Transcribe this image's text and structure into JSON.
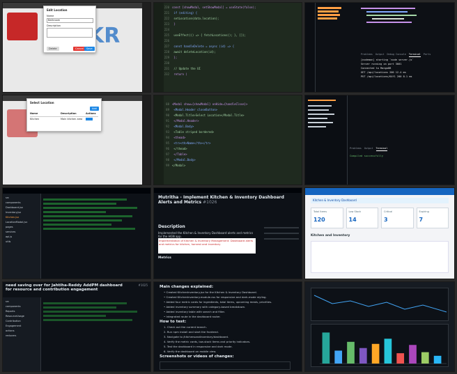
{
  "tiles": {
    "t1": {
      "dialog_title": "Edit Location",
      "field_name_label": "Name",
      "field_name_value": "Bathroom",
      "field_desc_label": "Description",
      "delete_label": "Delete",
      "cancel_label": "Cancel",
      "save_label": "Save",
      "logo_text": "KR"
    },
    "t2": {
      "lines": [
        {
          "n": "220",
          "code": "const [showModal, setShowModal] = useState(false);"
        },
        {
          "n": "221",
          "code": "  if (editing) {"
        },
        {
          "n": "222",
          "code": "    setLocation(data.location);"
        },
        {
          "n": "223",
          "code": "  }"
        },
        {
          "n": "224",
          "code": ""
        },
        {
          "n": "225",
          "code": "  useEffect(() => { fetchLocations(); }, []);"
        },
        {
          "n": "226",
          "code": ""
        },
        {
          "n": "227",
          "code": "  const handleDelete = async (id) => {"
        },
        {
          "n": "228",
          "code": "    await deleteLocation(id);"
        },
        {
          "n": "229",
          "code": "  };"
        },
        {
          "n": "230",
          "code": ""
        },
        {
          "n": "231",
          "code": "  // Update the UI"
        },
        {
          "n": "232",
          "code": "  return ("
        }
      ]
    },
    "t3": {
      "panel_tabs": [
        "Problems",
        "Output",
        "Debug Console",
        "Terminal",
        "Ports"
      ],
      "active_tab": "Terminal",
      "terminal_lines": [
        "[nodemon] starting `node server.js`",
        "Server running on port 3001",
        "Connected to MongoDB",
        "GET /api/locations 200 12.4 ms",
        "PUT /api/locations/64f1 200 8.1 ms"
      ]
    },
    "t4": {
      "dialog_title": "Select Location",
      "col_name": "Name",
      "col_description": "Description",
      "col_actions": "Actions",
      "row_name": "Kitchen",
      "row_desc": "Main kitchen area",
      "add_label": "Add"
    },
    "t5": {
      "lines": [
        {
          "n": "88",
          "code": "<Modal show={showModal} onHide={handleClose}>"
        },
        {
          "n": "89",
          "code": "  <Modal.Header closeButton>"
        },
        {
          "n": "90",
          "code": "    <Modal.Title>Select Location</Modal.Title>"
        },
        {
          "n": "91",
          "code": "  </Modal.Header>"
        },
        {
          "n": "92",
          "code": "  <Modal.Body>"
        },
        {
          "n": "93",
          "code": "    <Table striped bordered>"
        },
        {
          "n": "94",
          "code": "      <thead>"
        },
        {
          "n": "95",
          "code": "        <tr><th>Name</th></tr>"
        },
        {
          "n": "96",
          "code": "      </thead>"
        },
        {
          "n": "97",
          "code": "    </Table>"
        },
        {
          "n": "98",
          "code": "  </Modal.Body>"
        },
        {
          "n": "99",
          "code": "</Modal>"
        }
      ]
    },
    "t6": {
      "panel_tabs": [
        "Problems",
        "Output",
        "Terminal"
      ],
      "status": "Compiled successfully"
    },
    "t7": {
      "tree": [
        "src",
        "components",
        "Dashboard.jsx",
        "Inventory.jsx",
        "Kitchen.jsx",
        "LocationModal.jsx",
        "pages",
        "services",
        "api.js",
        "utils"
      ],
      "selected": "Kitchen.jsx"
    },
    "t8": {
      "title": "Mutritha - Implement Kitchen & Inventory Dashboard Alerts and Metrics",
      "pr_number": "#1026",
      "section": "Description",
      "body": "Implemented the Kitchen & Inventory Dashboard alerts and metrics for the HGN app.",
      "highlight": "Implementation of Kitchen & Inventory Management: Dashboard alerts and metrics for kitchen, harvest and inventory",
      "subheading": "Metrics"
    },
    "t9": {
      "banner": "Kitchen & Inventory Dashboard",
      "card_labels": [
        "Total Items",
        "Low Stock",
        "Critical",
        "Expiring"
      ],
      "card_values": [
        "120",
        "14",
        "3",
        "7"
      ],
      "section_title": "Kitchen and Inventory"
    },
    "t10": {
      "title": "need saving over for Jahtiha-Reddy AddPM dashboard for resource and contribution engagement",
      "pr_ref": "#1025",
      "tree": [
        "src",
        "components",
        "Reports",
        "ResourceUsage",
        "Contribution",
        "Engagement",
        "actions",
        "reducers"
      ]
    },
    "t11": {
      "heading_main": "Main changes explained:",
      "changes": [
        "Created KitchenInventory.jsx for the Kitchen & Inventory Dashboard.",
        "Created KitchenInventory.module.css for responsive and dark-mode styling.",
        "Added four metric cards for ingredients, total items, upcoming meals, priorities.",
        "Added inventory summary with category-based breakdown.",
        "Added inventory table with search and filter.",
        "Integrated route in the dashboard router."
      ],
      "heading_test": "How to test:",
      "tests": [
        "Check out the current branch.",
        "Run npm install and start the frontend.",
        "Navigate to /kitchensandinventory/dashboard.",
        "Verify the metric cards, low-stock items and priority indicators.",
        "Test the dashboard in responsive and dark mode.",
        "Verify the dashboard on mobile view."
      ],
      "heading_media": "Screenshots or videos of changes:"
    },
    "t12": {
      "chart_data": {
        "type": "bar",
        "categories": [
          "A",
          "B",
          "C",
          "D",
          "E",
          "F",
          "G",
          "H",
          "I",
          "J"
        ],
        "values": [
          60,
          25,
          42,
          30,
          38,
          48,
          20,
          36,
          22,
          15
        ],
        "ylim": [
          0,
          70
        ],
        "title": "",
        "xlabel": "",
        "ylabel": ""
      },
      "bar_colors": [
        "#26a69a",
        "#42a5f5",
        "#66bb6a",
        "#7e57c2",
        "#ffa726",
        "#26c6da",
        "#ef5350",
        "#ab47bc",
        "#9ccc65",
        "#29b6f6"
      ]
    }
  }
}
